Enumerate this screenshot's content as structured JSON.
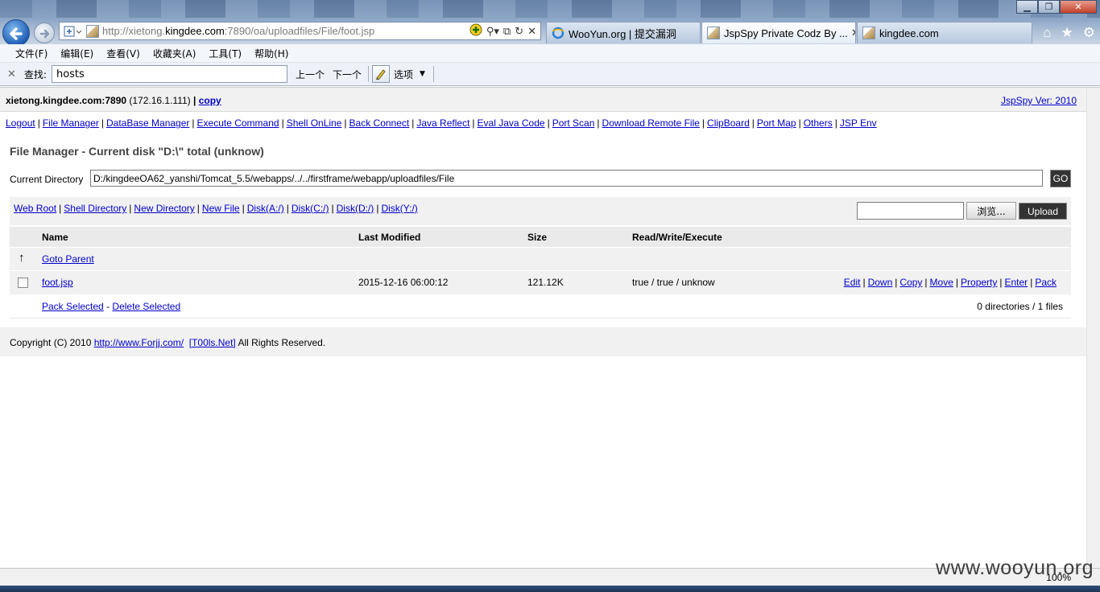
{
  "browser": {
    "address_url_prefix": "http://xietong.",
    "address_url_domain": "kingdee.com",
    "address_url_suffix": ":7890/oa/uploadfiles/File/foot.jsp",
    "tabs": [
      {
        "title": "WooYun.org | 提交漏洞"
      },
      {
        "title": "JspSpy Private Codz By ...",
        "active": true
      },
      {
        "title": "kingdee.com"
      }
    ],
    "menu": [
      "文件(F)",
      "编辑(E)",
      "查看(V)",
      "收藏夹(A)",
      "工具(T)",
      "帮助(H)"
    ],
    "find": {
      "close": "✕",
      "label": "查找:",
      "value": "hosts",
      "prev": "上一个",
      "next": "下一个",
      "options": "选项"
    },
    "zoom": "100%"
  },
  "header": {
    "host": "xietong.kingdee.com:7890",
    "ip": " (172.16.1.111) ",
    "pipe": "|",
    "copy": "copy",
    "version": "JspSpy Ver: 2010"
  },
  "tools": [
    "Logout",
    "File Manager",
    "DataBase Manager",
    "Execute Command",
    "Shell OnLine",
    "Back Connect",
    "Java Reflect",
    "Eval Java Code",
    "Port Scan",
    "Download Remote File",
    "ClipBoard",
    "Port Map",
    "Others",
    "JSP Env"
  ],
  "file_manager": {
    "title": "File Manager - Current disk \"D:\\\" total (unknow)",
    "current_dir_label": "Current Directory",
    "current_dir": "D:/kingdeeOA62_yanshi/Tomcat_5.5/webapps/../../firstframe/webapp/uploadfiles/File",
    "go_label": "GO",
    "disk_links": [
      "Web Root",
      "Shell Directory",
      "New Directory",
      "New File",
      "Disk(A:/)",
      "Disk(C:/)",
      "Disk(D:/)",
      "Disk(Y:/)"
    ],
    "browse_label": "浏览...",
    "upload_label": "Upload",
    "columns": {
      "name": "Name",
      "modified": "Last Modified",
      "size": "Size",
      "rwx": "Read/Write/Execute"
    },
    "parent_label": "Goto Parent",
    "files": [
      {
        "name": "foot.jsp",
        "modified": "2015-12-16 06:00:12",
        "size": "121.12K",
        "rwx": "true / true / unknow",
        "actions": [
          "Edit",
          "Down",
          "Copy",
          "Move",
          "Property",
          "Enter",
          "Pack"
        ]
      }
    ],
    "pack_selected": "Pack Selected",
    "dash": "-",
    "delete_selected": "Delete Selected",
    "summary": "0 directories / 1 files"
  },
  "footer": {
    "prefix": "Copyright (C) 2010 ",
    "link1": "http://www.Forjj.com/",
    "link2": "[T00ls.Net]",
    "suffix": " All Rights Reserved."
  },
  "watermark": "www.wooyun.org"
}
